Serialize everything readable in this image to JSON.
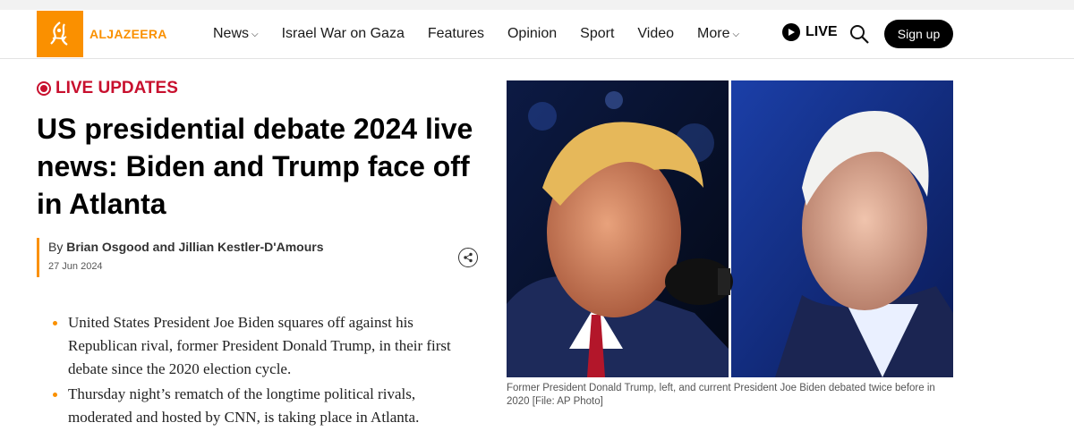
{
  "brand": {
    "name": "ALJAZEERA",
    "accent": "#fa9000"
  },
  "nav": {
    "items": [
      {
        "label": "News",
        "dropdown": true
      },
      {
        "label": "Israel War on Gaza",
        "dropdown": false
      },
      {
        "label": "Features",
        "dropdown": false
      },
      {
        "label": "Opinion",
        "dropdown": false
      },
      {
        "label": "Sport",
        "dropdown": false
      },
      {
        "label": "Video",
        "dropdown": false
      },
      {
        "label": "More",
        "dropdown": true
      }
    ],
    "live_label": "LIVE",
    "signup_label": "Sign up"
  },
  "article": {
    "live_badge": "LIVE UPDATES",
    "title": "US presidential debate 2024 live news: Biden and Trump face off in Atlanta",
    "byline_prefix": "By",
    "authors": "Brian Osgood and Jillian Kestler-D'Amours",
    "date": "27 Jun 2024",
    "bullets": [
      "United States President Joe Biden squares off against his Republican rival, former President Donald Trump, in their first debate since the 2020 election cycle.",
      "Thursday night’s rematch of the longtime political rivals, moderated and hosted by CNN, is taking place in Atlanta."
    ],
    "image_caption": "Former President Donald Trump, left, and current President Joe Biden debated twice before in 2020 [File: AP Photo]"
  },
  "colors": {
    "live_red": "#c8102e",
    "nav_text": "#1a1a1a"
  }
}
